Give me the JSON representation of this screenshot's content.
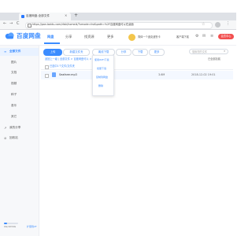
{
  "browser": {
    "tab_title": "百度网盘-全部文件",
    "tab_close": "×",
    "new_tab": "+",
    "nav_back": "←",
    "nav_forward": "→",
    "nav_reload": "C",
    "url": "https://pan.baidu.com/disk/home#/?vmode=list&path=%2F百度网盘可以在桌面",
    "star": "☆",
    "menu": "⋮",
    "colors": {
      "close": "#ff5f57",
      "minimize": "#febc2e",
      "maximize": "#28c840"
    }
  },
  "header": {
    "logo_text": "百度网盘",
    "nav": [
      {
        "label": "网盘"
      },
      {
        "label": "分享"
      },
      {
        "label": "找资源"
      },
      {
        "label": "更多"
      }
    ],
    "user_name": "简体一个迪克迪鲁卡",
    "client_link": "客户端下载",
    "icons": {
      "notice": "⚙",
      "mail": "✉",
      "settings": "≡"
    },
    "vip_button": "会员中心"
  },
  "sidebar": {
    "items": [
      {
        "label": "全部文件",
        "icon": "≡"
      },
      {
        "label": "图片"
      },
      {
        "label": "文档"
      },
      {
        "label": "视频"
      },
      {
        "label": "种子"
      },
      {
        "label": "音乐"
      },
      {
        "label": "其它"
      },
      {
        "label": "我的分享",
        "icon": "↗"
      },
      {
        "label": "回收站",
        "icon": "⊘"
      }
    ],
    "storage_text": "0G/1034G",
    "storage_fraction": 0.2,
    "expand_link": "扩容到2T"
  },
  "toolbar": {
    "upload": "上传",
    "new_folder": "新建文件夹",
    "offline": "离线下载",
    "share": "分享",
    "download": "下载",
    "more": "更多",
    "search_placeholder": "搜索您的文件"
  },
  "breadcrumb": "返回上一级 | 全部文件 > 百度网盘可以 > 在桌面",
  "loaded_count": "已全部加载",
  "selected_text": "已选中1个文件/文件夹",
  "files": [
    {
      "name": "Seafarer.mp3",
      "size": "3.6M",
      "date": "2018-12-02 19:01"
    }
  ],
  "dropdown": [
    "使用WIFI下载",
    "批量下载",
    "复制到网盘",
    "删除"
  ],
  "accent_color": "#3b8cff"
}
